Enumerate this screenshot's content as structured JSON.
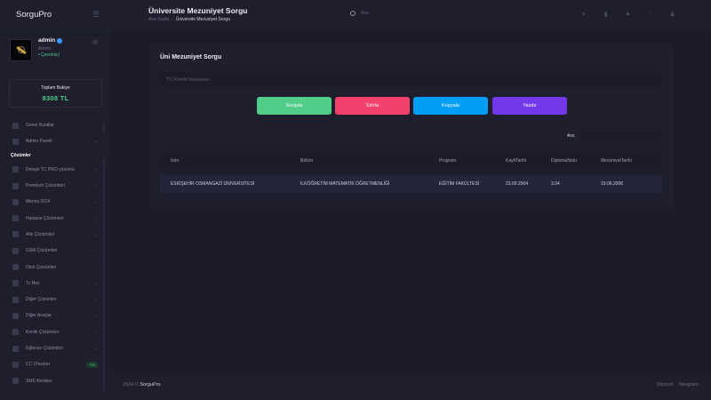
{
  "app": {
    "brand": "SorguPro"
  },
  "profile": {
    "name": "admin",
    "role": "Admin",
    "status": "• Çevrimiçi"
  },
  "balance": {
    "label": "Toplam Bakiye",
    "value": "8308 TL"
  },
  "menu": {
    "top_items": [
      {
        "label": "Genel Kurallar",
        "icon": "book-icon"
      },
      {
        "label": "Admin Paneli",
        "icon": "shield-icon"
      }
    ],
    "section_label": "Çözümler",
    "items": [
      {
        "label": "Detaylı TC PRO çözümü",
        "icon": "id-card-icon"
      },
      {
        "label": "Premium Çözümleri",
        "icon": "star-icon"
      },
      {
        "label": "Mernis 2024",
        "icon": "database-icon"
      },
      {
        "label": "Hastane Çözümleri",
        "icon": "hospital-icon"
      },
      {
        "label": "Aile Çözümleri",
        "icon": "family-icon"
      },
      {
        "label": "GSM Çözümleri",
        "icon": "phone-icon"
      },
      {
        "label": "Okul Çözümleri",
        "icon": "school-icon"
      },
      {
        "label": "Tv Box",
        "icon": "tv-icon"
      },
      {
        "label": "Diğer Çözümler",
        "icon": "grid-icon"
      },
      {
        "label": "Diğer Araçlar",
        "icon": "tool-icon"
      },
      {
        "label": "Kimlik Çözümleri",
        "icon": "user-icon"
      },
      {
        "label": "Eğlence Çözümleri",
        "icon": "music-icon"
      },
      {
        "label": "CC Checker",
        "icon": "card-icon",
        "badge": "YG"
      },
      {
        "label": "SMS Bomber",
        "icon": "message-icon"
      }
    ]
  },
  "header": {
    "title": "Üniversite Mezuniyet Sorgu",
    "breadcrumb_home": "Ana Sayfa",
    "breadcrumb_sep": "-",
    "breadcrumb_current": "Üniversite Mezuniyet Sorgu",
    "search_placeholder": "Ara"
  },
  "card": {
    "title": "Üni Mezuniyet Sorgu",
    "input_placeholder": "TC Kimlik Numarası",
    "buttons": {
      "sorgula": "Sorgula",
      "sifirla": "Sıfırla",
      "kopyala": "Kopyala",
      "yazdir": "Yazdır"
    },
    "search_label": "Ara:"
  },
  "table": {
    "columns": [
      "İsim",
      "Bölüm",
      "Program",
      "KayitTarihi",
      "DiplomaNotu",
      "MezuniyetTarihi"
    ],
    "rows": [
      [
        "ESKİŞEHİR OSMANGAZİ ÜNİVERSİTESİ",
        "İLKÖĞRETİM MATEMATİK ÖĞRETMENLİĞİ",
        "EĞİTİM FAKÜLTESİ",
        "23.09.2004",
        "3.04",
        "19.06.2006"
      ]
    ]
  },
  "footer": {
    "year": "2024 ©",
    "brand": "SorguPro",
    "links": [
      "Discord",
      "Telegram"
    ]
  },
  "colors": {
    "success": "#50cd89",
    "danger": "#f1416c",
    "primary": "#009ef7",
    "purple": "#7239ea"
  }
}
